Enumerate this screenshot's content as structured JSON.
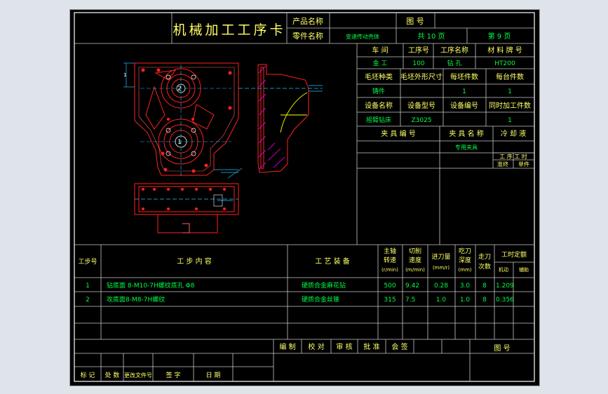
{
  "card": {
    "title": "机械加工工序卡",
    "product_name_label": "产品名称",
    "product_name_value": "",
    "drawing_no_label": "图 号",
    "drawing_no_value": "",
    "part_name_label": "零件名称",
    "part_name_value": "变速传动壳体",
    "total_pages": "共 10 页",
    "page_no": "第 9 页"
  },
  "header": {
    "workshop_label": "车 间",
    "process_no_label": "工序号",
    "process_name_label": "工序名称",
    "material_label": "材 料 牌 号",
    "workshop_value": "金 工",
    "process_no_value": "100",
    "process_name_value": "钻 孔",
    "material_value": "HT200",
    "blank_type_label": "毛坯种类",
    "blank_size_label": "毛坯外形尺寸",
    "blanks_per_label": "每坯件数",
    "pieces_per_label": "每台件数",
    "blank_type_value": "铸件",
    "blank_size_value": "",
    "blanks_per_value": "1",
    "pieces_per_value": "1",
    "equip_name_label": "设备名称",
    "equip_model_label": "设备型号",
    "equip_no_label": "设备编号",
    "simul_label": "同时加工件数",
    "equip_name_value": "摇臂钻床",
    "equip_model_value": "Z3025",
    "equip_no_value": "",
    "simul_value": "1",
    "fixture_no_label": "夹 具 编 号",
    "fixture_name_label": "夹 具 名 称",
    "coolant_label": "冷 却 液",
    "fixture_name_value": "专用夹具",
    "hours_label": "工 序 工 时",
    "prep_label": "准终",
    "single_label": "单件"
  },
  "steps_header": {
    "no": "工步号",
    "content": "工 步 内 容",
    "equipment": "工 艺 装 备",
    "spindle": [
      "主轴",
      "转速",
      "(r/min)"
    ],
    "cutting_speed": [
      "切削",
      "速度",
      "(m/min)"
    ],
    "feed": [
      "进刀量",
      "(mm/r)"
    ],
    "depth": [
      "吃刀",
      "深度",
      "(mm)"
    ],
    "passes": [
      "走刀",
      "次数"
    ],
    "hours_label": "工时定额",
    "hours_machine": "机动",
    "hours_aux": "辅助"
  },
  "steps": [
    {
      "no": "1",
      "content": "钻底面 8-M10-7H螺纹底孔 Φ8",
      "equipment": "硬质合金麻花钻",
      "spindle": "500",
      "speed": "9.42",
      "feed": "0.28",
      "depth": "3.0",
      "passes": "8",
      "time": "1.209"
    },
    {
      "no": "2",
      "content": "攻底面8-M8-7H螺纹",
      "equipment": "硬质合金丝锥",
      "spindle": "315",
      "speed": "7.5",
      "feed": "1.0",
      "depth": "1.0",
      "passes": "8",
      "time": "0.356"
    }
  ],
  "signoff": {
    "compile": "编 制",
    "proof": "校 对",
    "review": "审 核",
    "approve": "批 准",
    "countersign": "会 签",
    "figure_no": "图 号",
    "mark": "标 记",
    "qty": "处 数",
    "change_doc": "更改文件号",
    "signature": "签 字",
    "date": "日 期"
  },
  "drawing": {
    "label_1": "1",
    "label_2": "2",
    "dim_label": "1"
  },
  "colors": {
    "frame": "#ffffff",
    "grid": "#c8c8c8",
    "label_text": "#ffff66",
    "value_text": "#00ff44",
    "drawing_main": "#ff2020",
    "drawing_section": "#ff00ff",
    "drawing_dim": "#20c0ff",
    "drawing_hatch": "#ffff00"
  }
}
